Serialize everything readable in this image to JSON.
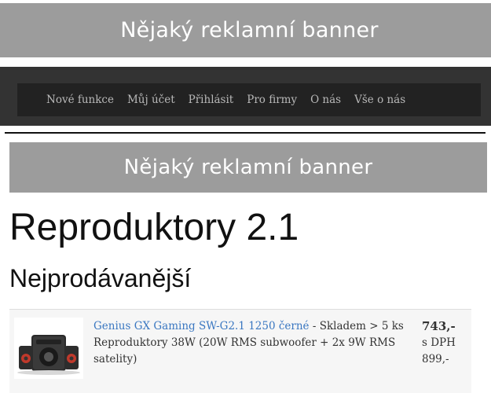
{
  "top_banner": {
    "text": "Nějaký reklamní banner"
  },
  "nav": {
    "items": [
      {
        "label": "Nové funkce"
      },
      {
        "label": "Můj účet"
      },
      {
        "label": "Přihlásit"
      },
      {
        "label": "Pro firmy"
      },
      {
        "label": "O nás"
      },
      {
        "label": "Vše o nás"
      }
    ]
  },
  "second_banner": {
    "text": "Nějaký reklamní banner"
  },
  "page": {
    "title": "Reproduktory 2.1",
    "section_title": "Nejprodávanější"
  },
  "products": [
    {
      "name": "Genius GX Gaming SW-G2.1 1250 černé",
      "availability": " - Skladem > 5 ks",
      "description": "Reproduktory 38W (20W RMS subwoofer + 2x 9W RMS satelity)",
      "price": "743,-",
      "vat_label": "s DPH",
      "price_with_vat": "899,-"
    }
  ],
  "colors": {
    "banner_bg": "#9c9c9c",
    "nav_bg": "#222222",
    "link": "#3a77c1"
  }
}
